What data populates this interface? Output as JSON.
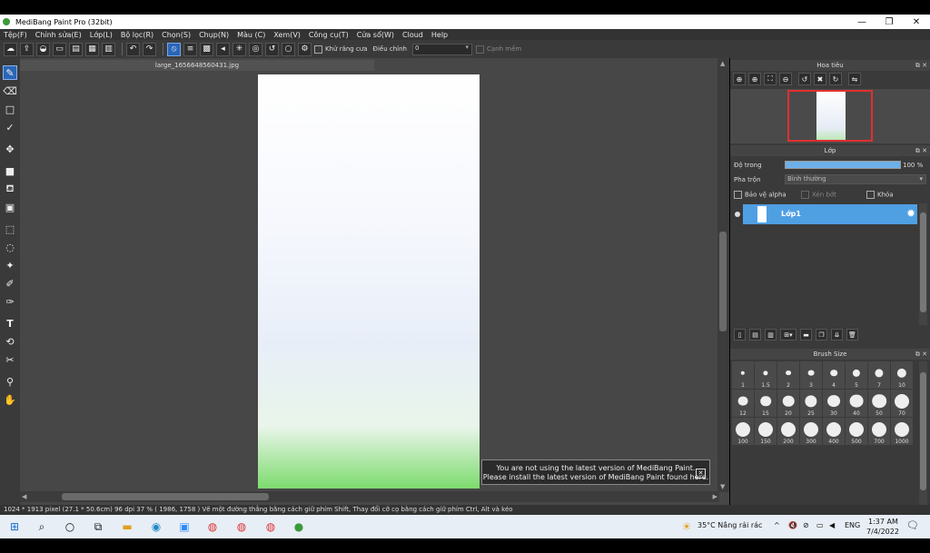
{
  "window": {
    "title": "MediBang Paint Pro (32bit)"
  },
  "menu": [
    "Tệp(F)",
    "Chỉnh sửa(E)",
    "Lớp(L)",
    "Bộ lọc(R)",
    "Chọn(S)",
    "Chụp(N)",
    "Màu (C)",
    "Xem(V)",
    "Công cụ(T)",
    "Cửa sổ(W)",
    "Cloud",
    "Help"
  ],
  "toolbar": {
    "antialias_label": "Khử răng cưa",
    "adjust_label": "Điều chỉnh",
    "adjust_value": "0",
    "smooth_label": "Cạnh mềm"
  },
  "document": {
    "tab_title": "large_1656648560431.jpg"
  },
  "notice": {
    "line1": "You are not using the latest version of MediBang Paint.",
    "line2": "Please install the latest version of MediBang Paint found here."
  },
  "navigator": {
    "title": "Hoa tiêu"
  },
  "layer_panel": {
    "title": "Lớp",
    "opacity_label": "Độ trong",
    "opacity_value": "100 %",
    "opacity_fraction": 1.0,
    "blend_label": "Pha trộn",
    "blend_value": "Bình thường",
    "protect_alpha": "Bảo vệ alpha",
    "clipping": "Xén bớt",
    "lock": "Khóa",
    "layers": [
      {
        "name": "Lớp1"
      }
    ]
  },
  "brush_size": {
    "title": "Brush Size",
    "sizes": [
      "1",
      "1.5",
      "2",
      "3",
      "4",
      "5",
      "7",
      "10",
      "12",
      "15",
      "20",
      "25",
      "30",
      "40",
      "50",
      "70",
      "100",
      "150",
      "200",
      "300",
      "400",
      "500",
      "700",
      "1000"
    ]
  },
  "status_bar": {
    "text": "1024 * 1913 pixel   (27.1 * 50.6cm)   96 dpi   37 %   ( 1986, 1758 )   Vẽ một đường thẳng bằng cách giữ phím Shift, Thay đổi cỡ cọ bằng cách giữ phím Ctrl, Alt và kéo"
  },
  "taskbar": {
    "weather": "35°C  Nắng rải rác",
    "language": "ENG",
    "time": "1:37 AM",
    "date": "7/4/2022"
  }
}
